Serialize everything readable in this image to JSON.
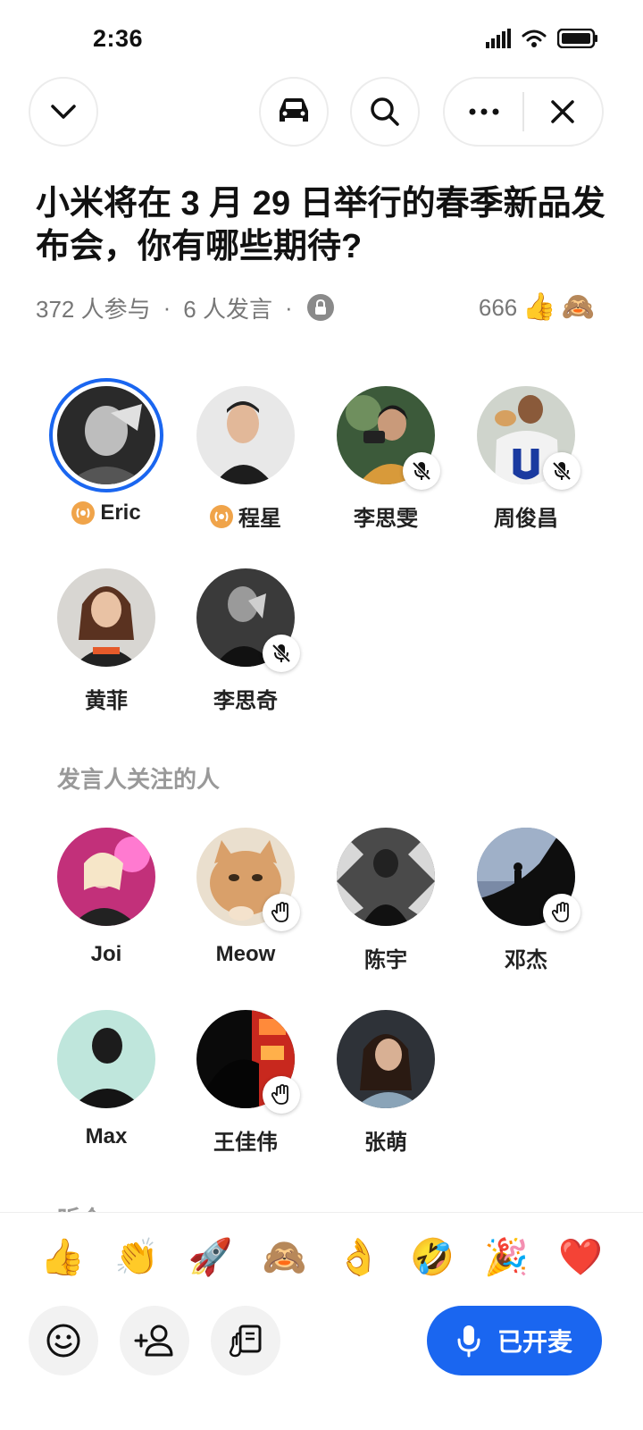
{
  "status": {
    "time": "2:36"
  },
  "room": {
    "title": "小米将在 3 月 29 日举行的春季新品发布会，你有哪些期待?",
    "participants": "372 人参与",
    "speakers_count": "6 人发言",
    "reaction_count": "666",
    "reaction_emojis": [
      "👍",
      "🙈"
    ]
  },
  "speakers": [
    {
      "name": "Eric",
      "role": "host",
      "active": true
    },
    {
      "name": "程星",
      "role": "host"
    },
    {
      "name": "李思雯",
      "muted": true
    },
    {
      "name": "周俊昌",
      "muted": true
    },
    {
      "name": "黄菲"
    },
    {
      "name": "李思奇",
      "muted": true
    }
  ],
  "followed_section": {
    "label": "发言人关注的人",
    "people": [
      {
        "name": "Joi"
      },
      {
        "name": "Meow",
        "hand_raised": true
      },
      {
        "name": "陈宇"
      },
      {
        "name": "邓杰",
        "hand_raised": true
      },
      {
        "name": "Max"
      },
      {
        "name": "王佳伟",
        "hand_raised": true
      },
      {
        "name": "张萌"
      }
    ]
  },
  "listeners_label": "听众",
  "emoji_bar": [
    "👍",
    "👏",
    "🚀",
    "🙈",
    "👌",
    "🤣",
    "🎉",
    "❤️"
  ],
  "mic_button": {
    "label": "已开麦"
  },
  "colors": {
    "accent": "#1a66f0",
    "host_badge": "#f0a44a",
    "muted_text": "#777777"
  }
}
